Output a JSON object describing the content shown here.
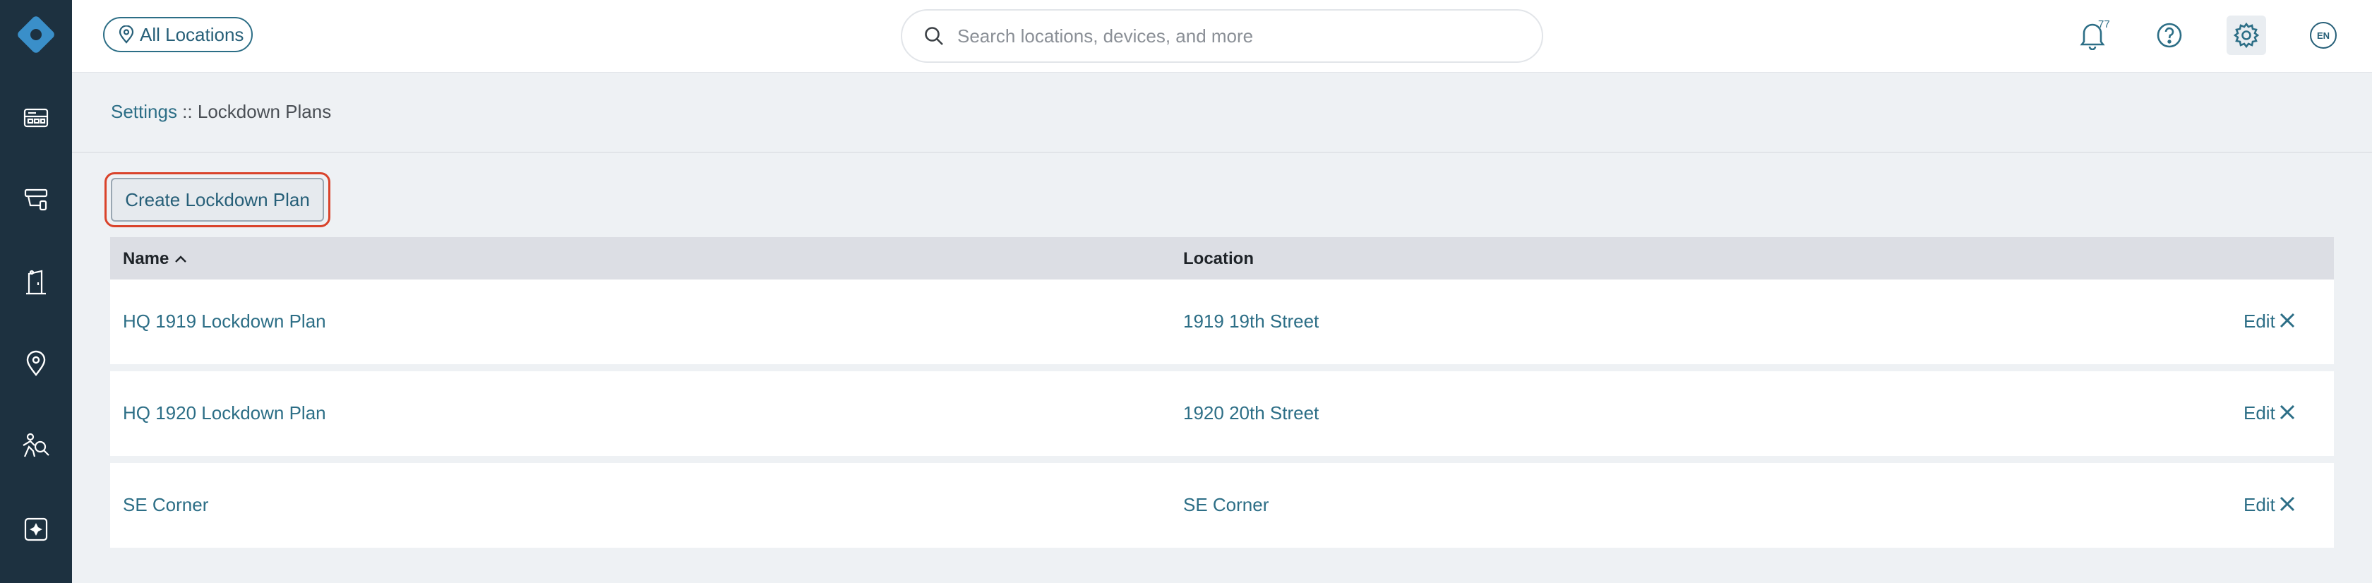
{
  "header": {
    "location_button": "All Locations",
    "search_placeholder": "Search locations, devices, and more",
    "notification_count": "77",
    "language": "EN"
  },
  "sidebar": {
    "items": [
      {
        "icon": "dashboard-icon"
      },
      {
        "icon": "devices-icon"
      },
      {
        "icon": "door-icon"
      },
      {
        "icon": "location-pin-icon"
      },
      {
        "icon": "person-search-icon"
      },
      {
        "icon": "integrations-icon"
      }
    ]
  },
  "breadcrumb": {
    "parent": "Settings",
    "separator": " :: ",
    "current": "Lockdown Plans"
  },
  "actions": {
    "create_label": "Create Lockdown Plan"
  },
  "table": {
    "columns": [
      "Name",
      "Location"
    ],
    "sort_icon": "chevron-up-icon",
    "rows": [
      {
        "name": "HQ 1919 Lockdown Plan",
        "location": "1919 19th Street",
        "edit": "Edit"
      },
      {
        "name": "HQ 1920 Lockdown Plan",
        "location": "1920 20th Street",
        "edit": "Edit"
      },
      {
        "name": "SE Corner",
        "location": "SE Corner",
        "edit": "Edit"
      }
    ]
  },
  "colors": {
    "sidebar_bg": "#1d3140",
    "accent": "#2c6e86",
    "highlight_outline": "#d9432b",
    "logo": "#3a8fc9"
  }
}
